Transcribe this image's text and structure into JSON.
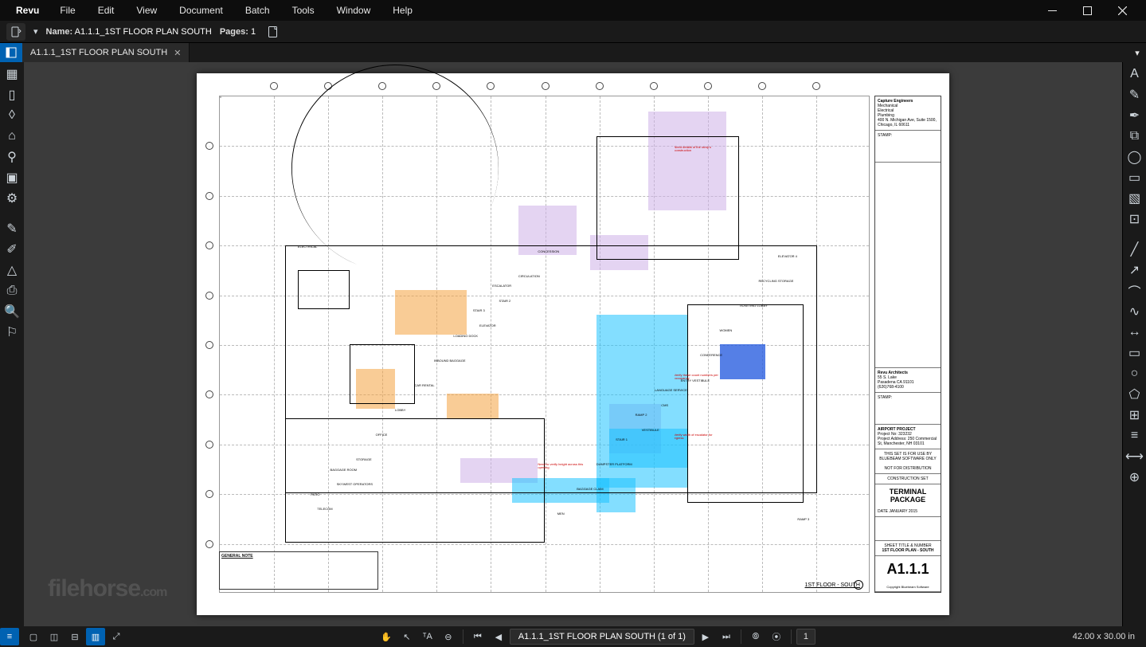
{
  "menu": {
    "app": "Revu",
    "items": [
      "File",
      "Edit",
      "View",
      "Document",
      "Batch",
      "Tools",
      "Window",
      "Help"
    ]
  },
  "info": {
    "name_label": "Name:",
    "name_value": "A1.1.1_1ST FLOOR PLAN SOUTH",
    "pages_label": "Pages:",
    "pages_value": "1"
  },
  "tab": {
    "title": "A1.1.1_1ST FLOOR PLAN SOUTH"
  },
  "left_rail": [
    {
      "name": "thumbnails-icon",
      "glyph": "▦"
    },
    {
      "name": "file-icon",
      "glyph": "▯"
    },
    {
      "name": "layers-icon",
      "glyph": "◊"
    },
    {
      "name": "tool-chest-icon",
      "glyph": "⌂"
    },
    {
      "name": "places-icon",
      "glyph": "⚲"
    },
    {
      "name": "sets-icon",
      "glyph": "▣"
    },
    {
      "name": "properties-icon",
      "glyph": "⚙"
    },
    {
      "name": "pen-icon",
      "glyph": "✎",
      "sep": true
    },
    {
      "name": "highlighter-icon",
      "glyph": "✐"
    },
    {
      "name": "eraser-icon",
      "glyph": "△"
    },
    {
      "name": "print-icon",
      "glyph": "⎙"
    },
    {
      "name": "search-icon",
      "glyph": "🔍"
    },
    {
      "name": "flag-icon",
      "glyph": "⚐"
    }
  ],
  "right_rail": [
    {
      "name": "text-box-icon",
      "glyph": "A"
    },
    {
      "name": "highlight-tool-icon",
      "glyph": "✎"
    },
    {
      "name": "pen-tool-icon",
      "glyph": "✒"
    },
    {
      "name": "snapshot-icon",
      "glyph": "⧉"
    },
    {
      "name": "cloud-icon",
      "glyph": "◯"
    },
    {
      "name": "callout-icon",
      "glyph": "▭"
    },
    {
      "name": "image-icon",
      "glyph": "▧"
    },
    {
      "name": "crop-icon",
      "glyph": "⊡"
    },
    {
      "name": "line-icon",
      "glyph": "╱",
      "sep": true
    },
    {
      "name": "arrow-icon",
      "glyph": "↗"
    },
    {
      "name": "arc-icon",
      "glyph": "⌒"
    },
    {
      "name": "polyline-icon",
      "glyph": "∿"
    },
    {
      "name": "dimension-icon",
      "glyph": "↔"
    },
    {
      "name": "rectangle-icon",
      "glyph": "▭"
    },
    {
      "name": "ellipse-icon",
      "glyph": "○"
    },
    {
      "name": "polygon-icon",
      "glyph": "⬠"
    },
    {
      "name": "group-icon",
      "glyph": "⊞"
    },
    {
      "name": "align-icon",
      "glyph": "≡"
    },
    {
      "name": "measure-icon",
      "glyph": "⟷"
    },
    {
      "name": "count-icon",
      "glyph": "⊕"
    }
  ],
  "status": {
    "page_display": "A1.1.1_1ST FLOOR PLAN SOUTH (1 of 1)",
    "part": "1",
    "dimensions": "42.00 x 30.00 in"
  },
  "titleblock": {
    "firm1": "Capture Engineers",
    "firm1_lines": "Mechanical\nElectrical\nPlumbing",
    "firm1_addr": "400 N. Michigan Ave, Suite 1500, Chicago, IL 60611",
    "stamp1": "STAMP:",
    "firm2": "Revu Architects",
    "firm2_addr": "55 S. Lake\nPasadena CA 91101\n(626)768-4100",
    "stamp2": "STAMP:",
    "project": "AIRPORT PROJECT",
    "project_no": "Project No: 323232",
    "project_addr_label": "Project Address:",
    "project_addr": "250 Commercial St, Manchester, NH 03101",
    "note1": "THIS SET IS FOR USE BY BLUEBEAM SOFTWARE ONLY",
    "note2": "NOT FOR DISTRIBUTION",
    "set": "CONSTRUCTION SET",
    "package": "TERMINAL PACKAGE",
    "date_label": "DATE",
    "date": "JANUARY 2015",
    "sheet_title_label": "SHEET TITLE & NUMBER",
    "sheet_title": "1ST FLOOR PLAN - SOUTH",
    "sheet_no": "A1.1.1",
    "copyright": "Copyright Bluebeam Software"
  },
  "plan": {
    "caption": "1ST FLOOR - SOUTH",
    "general_note_title": "GENERAL NOTE",
    "annotations": [
      "Need details of the ramp's construction",
      "Verify these count numbers per occupancy",
      "Verify width of escalator for egress",
      "Need to verify height across this opening"
    ],
    "rooms": [
      "ELECTRICAL",
      "VESTIBULE",
      "ELEVATOR",
      "TELECOM",
      "CMS",
      "STAIR 2",
      "SKYWEST OPERATORS",
      "ENTRY VESTIBULE",
      "CIRCULATION",
      "STORAGE",
      "CONFERENCE",
      "CONCESSION",
      "OFFICE",
      "WOMEN",
      "MEN",
      "LOBBY",
      "TICKETING LOBBY",
      "BAGGAGE CLAIM",
      "CAR RENTAL",
      "RECYCLING STORAGE",
      "DUMPSTER PLATFORM",
      "INBOUND BAGGAGE",
      "ELEVATOR 4",
      "STAIR 1",
      "LOADING DOCK",
      "RAMP 3",
      "RAMP 2",
      "STAIR 3",
      "PATIO",
      "LANGUAGE SERVICE",
      "ESCALATOR",
      "BAGGAGE ROOM"
    ]
  },
  "watermark": "filehorse",
  "watermark_ext": ".com"
}
